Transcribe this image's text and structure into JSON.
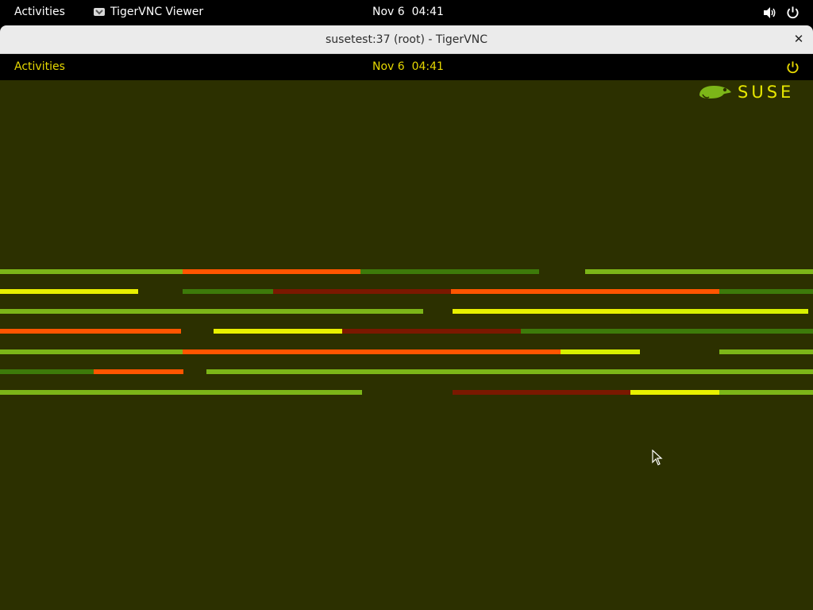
{
  "host_bar": {
    "activities": "Activities",
    "app_name": "TigerVNC Viewer",
    "clock": "Nov 6  04:41"
  },
  "window": {
    "title": "susetest:37 (root) - TigerVNC",
    "close_glyph": "✕"
  },
  "remote_bar": {
    "activities": "Activities",
    "clock": "Nov 6  04:41"
  },
  "logo": {
    "text": "SUSE"
  },
  "colors": {
    "desktop_bg": "#2c3000",
    "accent_yellow": "#e6d800",
    "light_green": "#7cb518",
    "dark_green": "#3d7a0a",
    "orange": "#ff5500",
    "yellow": "#e8f000",
    "dark_red": "#7a1800"
  },
  "icons": [
    "appicon",
    "volume-icon",
    "power-icon",
    "close-icon",
    "suse-chameleon-logo",
    "mouse-pointer-icon"
  ]
}
